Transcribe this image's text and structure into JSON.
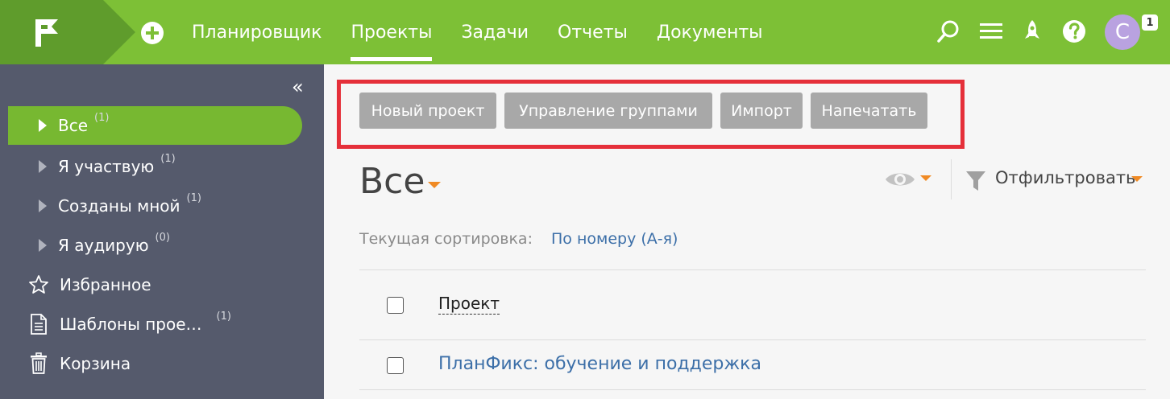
{
  "topbar": {
    "nav": [
      "Планировщик",
      "Проекты",
      "Задачи",
      "Отчеты",
      "Документы"
    ],
    "active_nav": "Проекты",
    "avatar_letter": "С",
    "notification_count": "1",
    "icons": [
      "logo-flag-icon",
      "add-icon",
      "search-icon",
      "menu-icon",
      "rocket-icon",
      "help-icon"
    ]
  },
  "sidebar": {
    "collapse": "«",
    "items": [
      {
        "label": "Все",
        "count": "(1)"
      },
      {
        "label": "Я участвую",
        "count": "(1)"
      },
      {
        "label": "Созданы мной",
        "count": "(1)"
      },
      {
        "label": "Я аудирую",
        "count": "(0)"
      },
      {
        "label": "Избранное",
        "count": ""
      },
      {
        "label": "Шаблоны прое…",
        "count": "(1)"
      },
      {
        "label": "Корзина",
        "count": ""
      }
    ]
  },
  "toolbar": {
    "buttons": [
      "Новый проект",
      "Управление группами",
      "Импорт",
      "Напечатать"
    ]
  },
  "main": {
    "title": "Все",
    "filter_label": "Отфильтровать",
    "sort_label": "Текущая сортировка:",
    "sort_value": "По номеру (А-я)",
    "column_header": "Проект",
    "rows": [
      "ПланФикс: обучение и поддержка"
    ]
  },
  "colors": {
    "topbar": "#7dc036",
    "sidebar": "#555a6c",
    "active_item": "#77b831",
    "highlight_frame": "#e5303a",
    "accent_caret": "#f08a24",
    "link": "#3c6fa8"
  }
}
